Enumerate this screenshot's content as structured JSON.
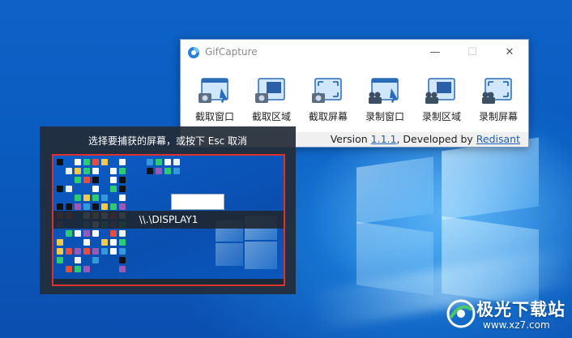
{
  "app": {
    "title": "GifCapture",
    "window_controls": {
      "minimize": "—",
      "maximize": "☐",
      "close": "✕"
    },
    "tools": [
      {
        "label": "截取窗口",
        "icon": "camera-window-icon"
      },
      {
        "label": "截取区域",
        "icon": "camera-region-icon"
      },
      {
        "label": "截取屏幕",
        "icon": "camera-screen-icon"
      },
      {
        "label": "录制窗口",
        "icon": "video-window-icon"
      },
      {
        "label": "录制区域",
        "icon": "video-region-icon"
      },
      {
        "label": "录制屏幕",
        "icon": "video-screen-icon"
      }
    ],
    "status": {
      "prefix": "Version ",
      "version": "1.1.1",
      "middle": ", Developed by ",
      "developer": "Redisant"
    }
  },
  "selector": {
    "hint": "选择要捕获的屏幕，或按下 Esc 取消",
    "display_name": "\\\\.\\DISPLAY1"
  },
  "watermark": {
    "text": "极光下载站",
    "url": "www.xz7.com"
  },
  "colors": {
    "accent": "#1a5fb4",
    "selection_border": "#e0302a",
    "desktop_blue": "#0b5cc6"
  }
}
